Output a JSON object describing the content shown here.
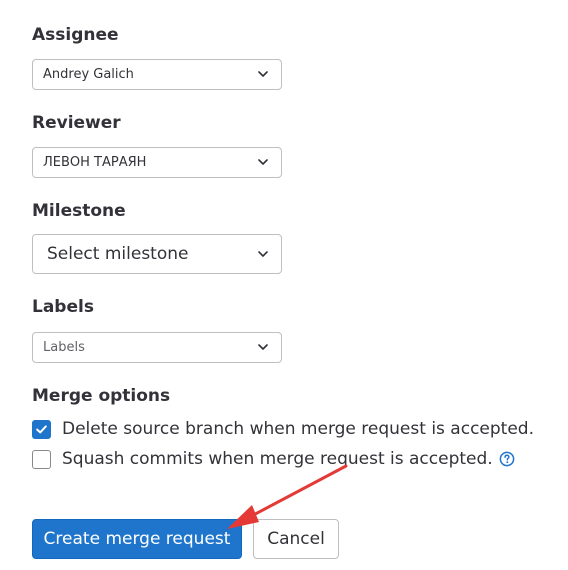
{
  "assignee": {
    "label": "Assignee",
    "value": "Andrey Galich"
  },
  "reviewer": {
    "label": "Reviewer",
    "value": "ЛЕВОН ТАРАЯН"
  },
  "milestone": {
    "label": "Milestone",
    "value": "Select milestone"
  },
  "labels": {
    "label": "Labels",
    "value": "Labels"
  },
  "merge_options": {
    "label": "Merge options",
    "delete_source": {
      "text": "Delete source branch when merge request is accepted.",
      "checked": true
    },
    "squash": {
      "text": "Squash commits when merge request is accepted.",
      "checked": false
    }
  },
  "actions": {
    "create_label": "Create merge request",
    "cancel_label": "Cancel"
  },
  "colors": {
    "primary": "#1f75cb",
    "annotation_arrow": "#e53935"
  }
}
